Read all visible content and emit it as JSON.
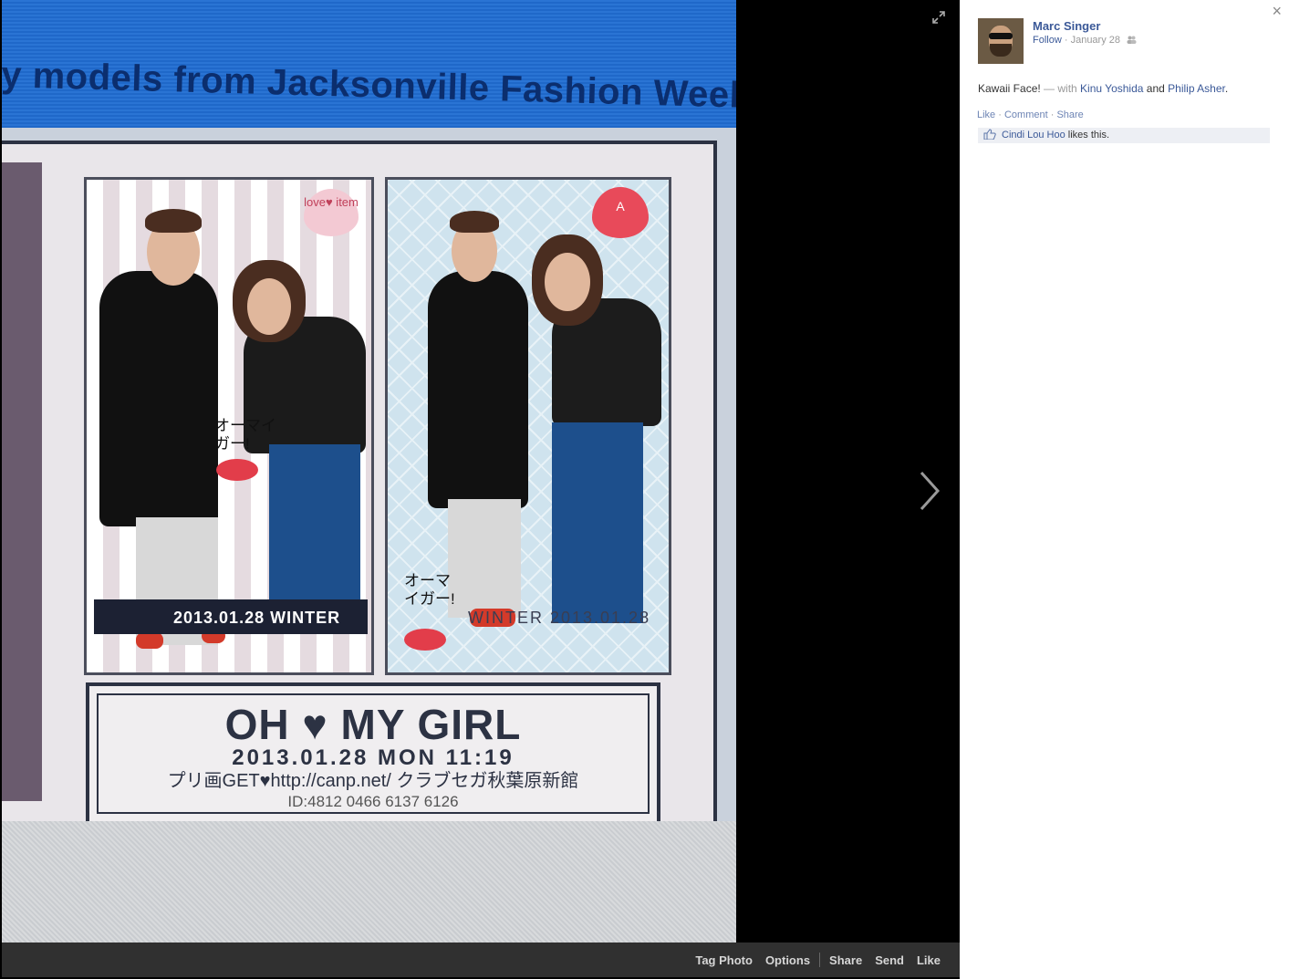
{
  "photo": {
    "banner_text": "y models from Jacksonville Fashion Week",
    "frame1_date": "2013.01.28   WINTER",
    "frame1_sticker": "love♥ item",
    "frame2_heart": "A",
    "frame2_text": "WINTER  2013.01.28",
    "callout_jp": "オーマイガー!",
    "footer_title": "OH ♥ MY GIRL",
    "footer_date": "2013.01.28 MON 11:19",
    "footer_url": "プリ画GET♥http://canp.net/ クラブセガ秋葉原新館",
    "footer_id": "ID:4812 0466 6137 6126"
  },
  "toolbar": {
    "tag_photo": "Tag Photo",
    "options": "Options",
    "share": "Share",
    "send": "Send",
    "like": "Like"
  },
  "icons": {
    "expand": "expand-icon",
    "next": "chevron-right-icon",
    "close": "close-icon"
  },
  "sidebar": {
    "close": "×",
    "author": "Marc Singer",
    "follow": "Follow",
    "dot": " · ",
    "date": "January 28",
    "caption_text": "Kawaii Face!",
    "with_prefix": " — with ",
    "tag1": "Kinu Yoshida",
    "and": " and ",
    "tag2": "Philip Asher",
    "period": ".",
    "action_like": "Like",
    "action_comment": "Comment",
    "action_share": "Share",
    "liker": "Cindi Lou Hoo",
    "likes_suffix": " likes this."
  },
  "colors": {
    "link": "#3b5998",
    "likes_bg": "#edeff4",
    "toolbar_bg": "#303030"
  }
}
